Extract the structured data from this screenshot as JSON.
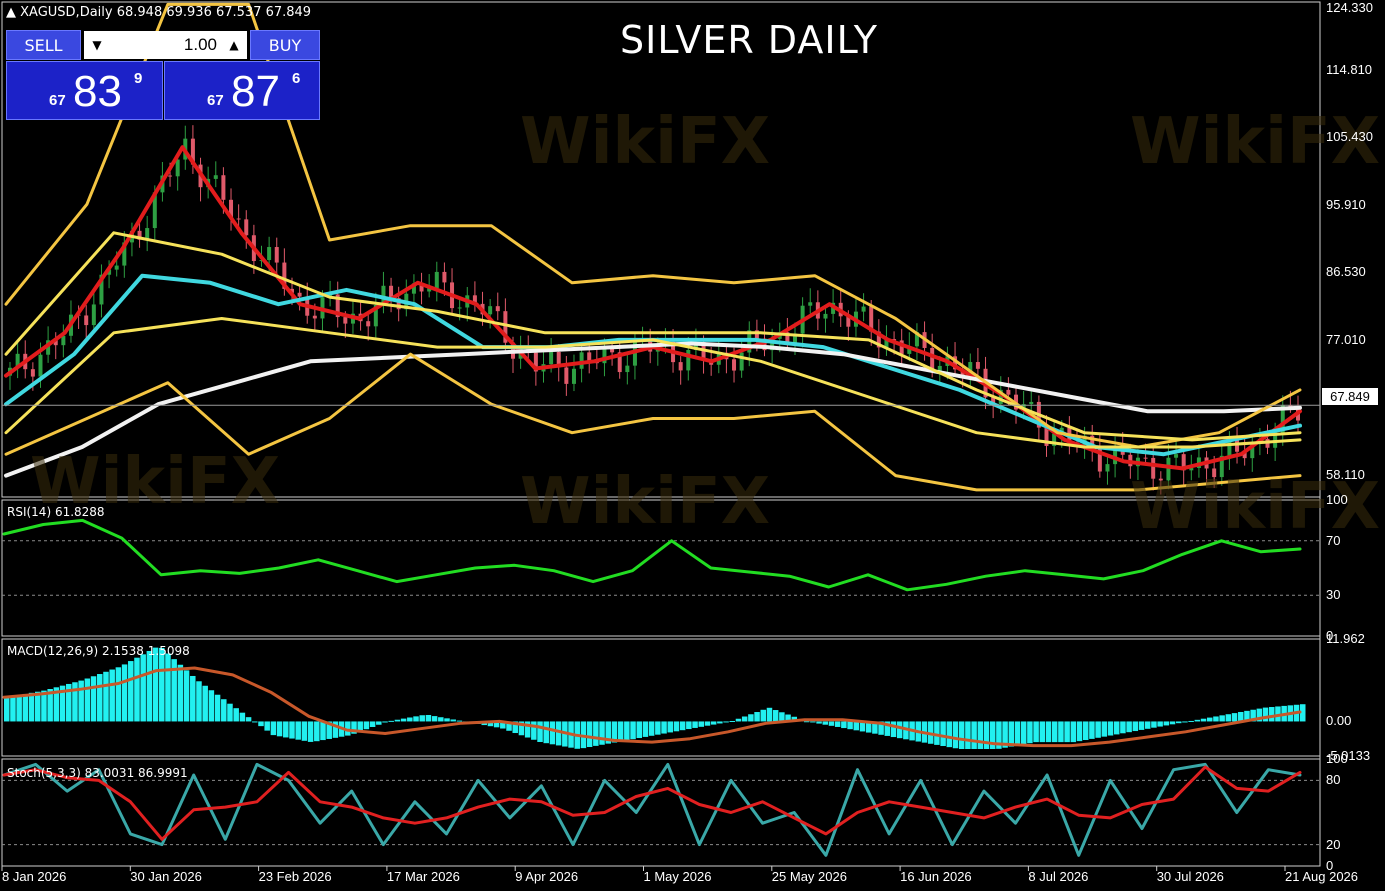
{
  "header": {
    "symbol": "XAGUSD,Daily",
    "ohlc": "68.948 69.936 67.537 67.849"
  },
  "title": "SILVER DAILY",
  "trade_panel": {
    "sell_label": "SELL",
    "buy_label": "BUY",
    "lot": "1.00",
    "sell_price": {
      "big_prefix": "67",
      "main": "83",
      "sup": "9"
    },
    "buy_price": {
      "big_prefix": "67",
      "main": "87",
      "sup": "6"
    }
  },
  "main_pane": {
    "y_ticks": [
      "124.330",
      "114.810",
      "105.430",
      "95.910",
      "86.530",
      "77.010",
      "67.849",
      "58.110"
    ],
    "current_price": "67.849"
  },
  "rsi_pane": {
    "label": "RSI(14) 61.8288",
    "y_ticks": [
      "100",
      "70",
      "30",
      "0"
    ]
  },
  "macd_pane": {
    "label": "MACD(12,26,9) 2.1538 1.5098",
    "y_ticks": [
      "11.962",
      "0.00",
      "-5.0133"
    ]
  },
  "stoch_pane": {
    "label": "Stoch(5,3,3) 83.0031 86.9991",
    "y_ticks": [
      "100",
      "80",
      "20",
      "0"
    ]
  },
  "x_labels": [
    "8 Jan 2026",
    "30 Jan 2026",
    "23 Feb 2026",
    "17 Mar 2026",
    "9 Apr 2026",
    "1 May 2026",
    "25 May 2026",
    "16 Jun 2026",
    "8 Jul 2026",
    "30 Jul 2026",
    "21 Aug 2026"
  ],
  "watermark": "WikiFX",
  "colors": {
    "bull": "#2ea043",
    "bear": "#e05a6a",
    "ema_fast": "#e21c1c",
    "ema_mid": "#40d8e0",
    "ma_slow": "#f2f2f2",
    "band": "#f4c542",
    "band_inner": "#f6e25a",
    "rsi": "#22dd22",
    "macd_hist": "#22f0f0",
    "macd_signal": "#c8582a",
    "stoch_k": "#3aa8a8",
    "stoch_d": "#e02020"
  },
  "chart_data": [
    {
      "type": "line",
      "name": "main",
      "ylim": [
        55,
        124.33
      ],
      "x_labels": [
        "8 Jan 2026",
        "30 Jan 2026",
        "23 Feb 2026",
        "17 Mar 2026",
        "9 Apr 2026",
        "1 May 2026",
        "25 May 2026",
        "16 Jun 2026",
        "8 Jul 2026",
        "30 Jul 2026",
        "21 Aug 2026"
      ],
      "series": [
        {
          "role": "ema_fast",
          "values": [
            72,
            78,
            90,
            104,
            92,
            82,
            80,
            85,
            82,
            73,
            74,
            76,
            74,
            77,
            82,
            77,
            74,
            69,
            63,
            60,
            59,
            61,
            67
          ]
        },
        {
          "role": "ema_mid",
          "values": [
            68,
            75,
            86,
            85,
            82,
            84,
            82,
            76,
            76,
            77,
            77,
            77,
            76,
            73,
            70,
            66,
            62,
            61,
            63,
            65
          ]
        },
        {
          "role": "ma_slow",
          "values": [
            58,
            62,
            68,
            71,
            74,
            74.5,
            75,
            75.5,
            76,
            76.5,
            76,
            75,
            73,
            71,
            69,
            67,
            67,
            67.5
          ]
        },
        {
          "role": "band_upper",
          "values": [
            82,
            96,
            124,
            124,
            91,
            93,
            93,
            85,
            86,
            85,
            86,
            80,
            72,
            64,
            62,
            64,
            70
          ]
        },
        {
          "role": "band_lower",
          "values": [
            61,
            66,
            71,
            61,
            66,
            75,
            68,
            64,
            66,
            66,
            67,
            58,
            56,
            56,
            56,
            57,
            58
          ]
        },
        {
          "role": "band_inner_upper",
          "values": [
            75,
            92,
            89,
            83,
            81,
            78,
            78,
            78,
            77,
            70,
            64,
            63,
            64
          ]
        },
        {
          "role": "band_inner_lower",
          "values": [
            64,
            78,
            80,
            78,
            76,
            76,
            77,
            74,
            69,
            64,
            62,
            62,
            63
          ]
        }
      ]
    },
    {
      "type": "line",
      "name": "RSI(14)",
      "ylim": [
        0,
        100
      ],
      "values": [
        75,
        82,
        85,
        72,
        45,
        48,
        46,
        50,
        56,
        48,
        40,
        45,
        50,
        52,
        48,
        40,
        48,
        70,
        50,
        47,
        44,
        36,
        45,
        34,
        38,
        44,
        48,
        45,
        42,
        48,
        60,
        70,
        62,
        64
      ]
    },
    {
      "type": "bar",
      "name": "MACD(12,26,9)",
      "ylim": [
        -5.0133,
        11.962
      ],
      "values": [
        3.5,
        4.5,
        6,
        8,
        11,
        6,
        2,
        -2,
        -3,
        -2,
        0,
        1,
        0,
        -1,
        -3,
        -4,
        -3,
        -2,
        -1,
        0,
        2,
        0,
        -1,
        -2,
        -3,
        -4,
        -4,
        -3,
        -3,
        -2,
        -1,
        0,
        1,
        2,
        2.5
      ]
    },
    {
      "type": "line",
      "name": "Stoch(5,3,3)",
      "ylim": [
        0,
        100
      ],
      "values": [
        85,
        95,
        70,
        90,
        30,
        20,
        85,
        25,
        95,
        80,
        40,
        70,
        20,
        60,
        30,
        80,
        45,
        75,
        20,
        80,
        50,
        95,
        20,
        80,
        40,
        50,
        10,
        90,
        30,
        80,
        20,
        70,
        40,
        85,
        10,
        80,
        35,
        90,
        95,
        50,
        90,
        85
      ]
    }
  ]
}
